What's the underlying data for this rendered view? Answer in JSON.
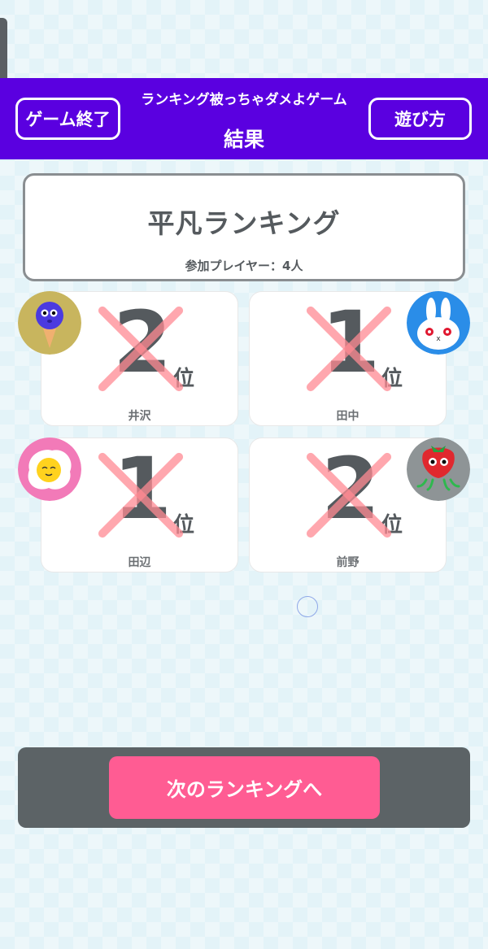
{
  "header": {
    "subtitle": "ランキング被っちゃダメよゲーム",
    "title": "結果",
    "quit_label": "ゲーム終了",
    "howto_label": "遊び方",
    "bg_color": "#5a00e0"
  },
  "ranking": {
    "name": "平凡ランキング",
    "players": "参加プレイヤー：4人"
  },
  "cards": [
    {
      "player": "井沢",
      "rank": "2",
      "suffix": "位",
      "avatar": "blue-icecream-icon",
      "crossed": true
    },
    {
      "player": "田中",
      "rank": "1",
      "suffix": "位",
      "avatar": "white-rabbit-icon",
      "crossed": true
    },
    {
      "player": "田辺",
      "rank": "1",
      "suffix": "位",
      "avatar": "fried-egg-icon",
      "crossed": true
    },
    {
      "player": "前野",
      "rank": "2",
      "suffix": "位",
      "avatar": "strawberry-octopus-icon",
      "crossed": true
    }
  ],
  "footer": {
    "next_label": "次のランキングへ",
    "button_color": "#ff5c93"
  }
}
